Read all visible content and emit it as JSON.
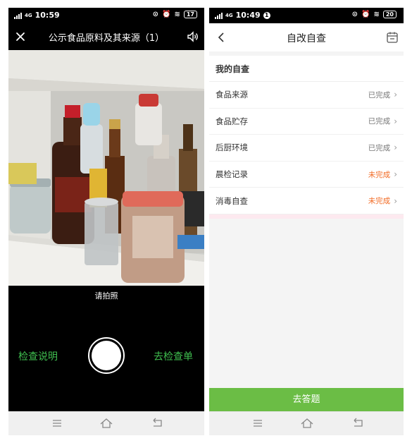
{
  "left_phone": {
    "status": {
      "time": "10:59",
      "network": "4G",
      "battery": "17"
    },
    "header": {
      "title": "公示食品原料及其来源（1）",
      "close_icon": "close-icon",
      "sound_icon": "speaker-icon"
    },
    "camera": {
      "hint": "请拍照",
      "guide_label": "检查说明",
      "checklist_label": "去检查单"
    }
  },
  "right_phone": {
    "status": {
      "time": "10:49",
      "network": "4G",
      "battery": "20",
      "notification": "1"
    },
    "header": {
      "title": "自改自查",
      "back_icon": "chevron-left-icon",
      "calendar_icon": "calendar-icon"
    },
    "section_title": "我的自查",
    "items": [
      {
        "label": "食品来源",
        "status": "已完成",
        "state": "done"
      },
      {
        "label": "食品贮存",
        "status": "已完成",
        "state": "done"
      },
      {
        "label": "后厨环境",
        "status": "已完成",
        "state": "done"
      },
      {
        "label": "晨检记录",
        "status": "未完成",
        "state": "todo"
      },
      {
        "label": "消毒自查",
        "status": "未完成",
        "state": "todo"
      }
    ],
    "answer_button": "去答题"
  },
  "colors": {
    "accent_green": "#6bbd45",
    "label_green": "#3fbf4f",
    "incomplete_orange": "#f26b25"
  }
}
